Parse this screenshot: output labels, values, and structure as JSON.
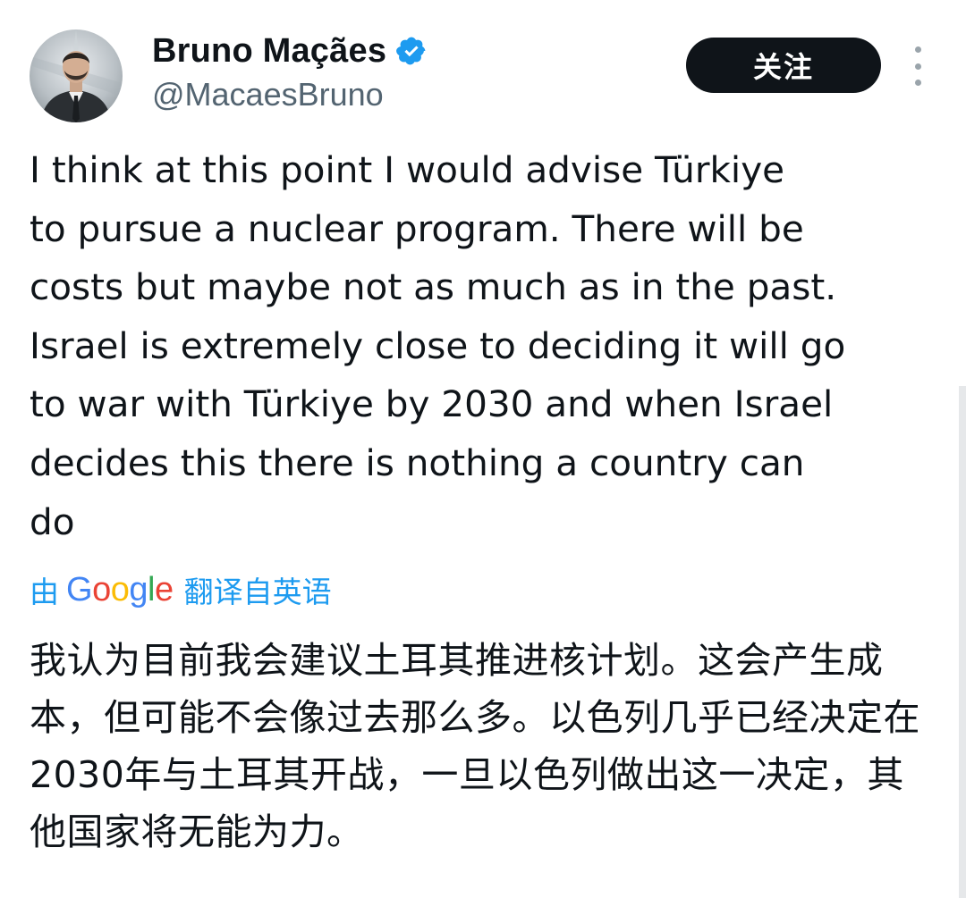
{
  "author": {
    "display_name": "Bruno Maçães",
    "handle": "@MacaesBruno",
    "verified": true,
    "avatar_icon": "profile-photo"
  },
  "actions": {
    "follow_label": "关注",
    "more_icon": "vertical-ellipsis-icon"
  },
  "tweet": {
    "text": "I think at this point I would advise Türkiye\nto pursue a nuclear program. There will be\ncosts but maybe not as much as in the past.\nIsrael is extremely close to deciding it will go\nto war with Türkiye by 2030 and when Israel\ndecides this there is nothing a country can\ndo"
  },
  "translation": {
    "prefix": "由",
    "provider": "Google",
    "suffix": "翻译自英语",
    "text": "我认为目前我会建议土耳其推进核计划。这会产生成本，但可能不会像过去那么多。以色列几乎已经决定在2030年与土耳其开战，一旦以色列做出这一决定，其他国家将无能为力。"
  },
  "colors": {
    "link": "#1d9bf0",
    "follow_bg": "#0f1419",
    "text": "#0f1419",
    "secondary": "#536471"
  }
}
